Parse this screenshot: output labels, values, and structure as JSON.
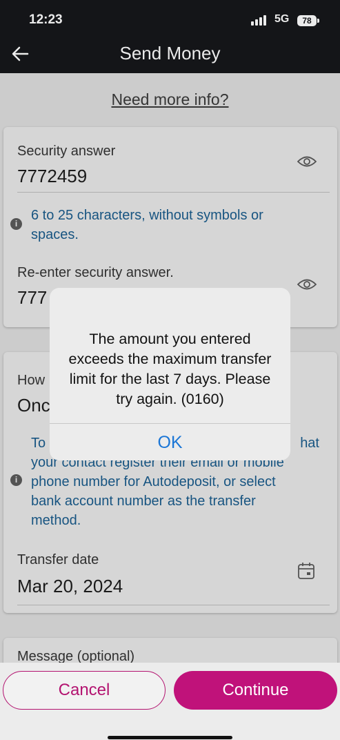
{
  "status": {
    "time": "12:23",
    "network": "5G",
    "battery": "78"
  },
  "nav": {
    "title": "Send Money",
    "back_icon": "back-arrow-icon"
  },
  "page": {
    "info_link": "Need more info?"
  },
  "security": {
    "answer_label": "Security answer",
    "answer_value": "7772459",
    "hint": "6 to 25 characters, without symbols or spaces.",
    "reenter_label": "Re-enter security answer.",
    "reenter_value": "777"
  },
  "transfer": {
    "frequency_label": "How",
    "frequency_value": "Onc",
    "notice": "To … hat your contact register their email or mobile phone number for Autodeposit, or select bank account number as the transfer method.",
    "notice_line1_left": "To",
    "notice_line1_right": "hat",
    "notice_line2": "your contact register their email or mobile",
    "notice_line3": "phone number for Autodeposit, or select",
    "notice_line4": "bank account number as the transfer",
    "notice_line5": "method.",
    "date_label": "Transfer date",
    "date_value": "Mar 20, 2024"
  },
  "message": {
    "label": "Message (optional)"
  },
  "dialog": {
    "message": "The amount you entered exceeds the maximum transfer limit for the last 7 days. Please try again. (0160)",
    "ok_label": "OK"
  },
  "actions": {
    "cancel_label": "Cancel",
    "continue_label": "Continue"
  },
  "colors": {
    "accent": "#c0127a",
    "link": "#1b76d6",
    "hint_text": "#1a5c8c"
  }
}
